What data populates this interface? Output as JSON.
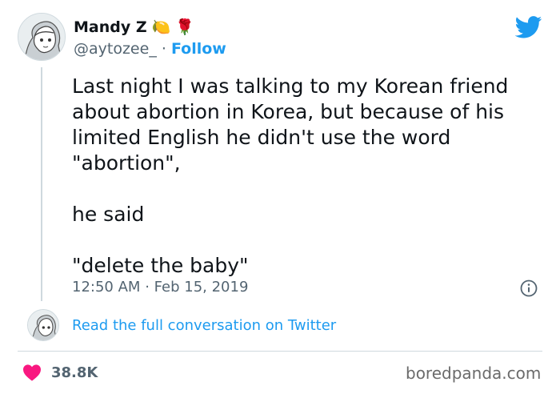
{
  "author": {
    "name": "Mandy Z",
    "emoji": [
      "🍋",
      "🌹"
    ],
    "handle": "@aytozee_",
    "separator": "·",
    "follow_label": "Follow"
  },
  "tweet": {
    "paragraphs": [
      "Last night I was talking to my Korean friend about abortion in Korea, but because of his limited English he didn't use the word \"abortion\",",
      "he said",
      "\"delete the baby\""
    ],
    "time": "12:50 AM",
    "meta_separator": "·",
    "date": "Feb 15, 2019"
  },
  "conversation_link": "Read the full conversation on Twitter",
  "likes": {
    "count": "38.8K"
  },
  "watermark": "boredpanda.com",
  "colors": {
    "accent": "#1d9bf0",
    "heart": "#f91880",
    "text": "#0f1419",
    "secondary": "#536471"
  },
  "icons": {
    "brand": "twitter-bird-icon",
    "info": "info-icon",
    "like": "heart-icon"
  }
}
